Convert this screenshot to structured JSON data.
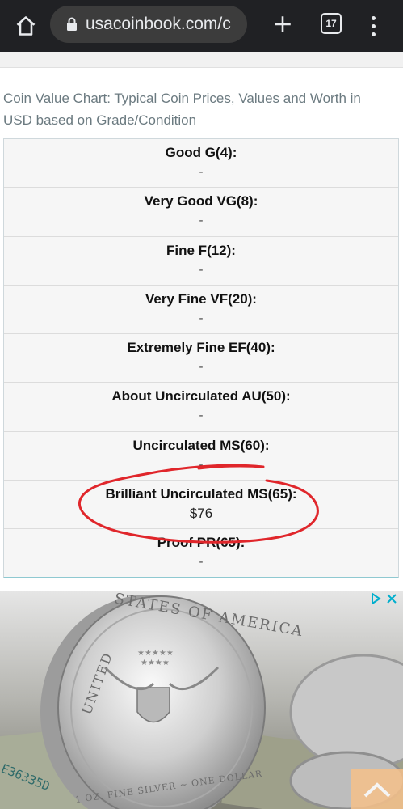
{
  "browser": {
    "url": "usacoinbook.com/c",
    "tab_count": "17",
    "icons": [
      "home-icon",
      "lock-icon",
      "plus-icon",
      "tabs-icon",
      "more-vert-icon"
    ]
  },
  "caption": "Coin Value Chart: Typical Coin Prices, Values and Worth in USD based on Grade/Condition",
  "table": {
    "rows": [
      {
        "label": "Good G(4):",
        "value": "-"
      },
      {
        "label": "Very Good VG(8):",
        "value": "-"
      },
      {
        "label": "Fine F(12):",
        "value": "-"
      },
      {
        "label": "Very Fine VF(20):",
        "value": "-"
      },
      {
        "label": "Extremely Fine EF(40):",
        "value": "-"
      },
      {
        "label": "About Uncirculated AU(50):",
        "value": "-"
      },
      {
        "label": "Uncirculated MS(60):",
        "value": "-"
      },
      {
        "label": "Brilliant Uncirculated MS(65):",
        "value": "$76"
      },
      {
        "label": "Proof PR(65):",
        "value": "-"
      }
    ]
  },
  "ad": {
    "coin_top_text": "STATES OF AMERICA",
    "coin_left_text": "UNITED",
    "coin_bottom_text": "1 OZ. FINE SILVER ~ ONE DOLLAR",
    "bill_serial": "E36335D",
    "icons": [
      "adchoices-icon",
      "close-icon",
      "chevron-up-icon"
    ]
  },
  "colors": {
    "browser_bar": "#202124",
    "annotation_red": "#e0262b",
    "table_accent": "#8fc9d1"
  }
}
